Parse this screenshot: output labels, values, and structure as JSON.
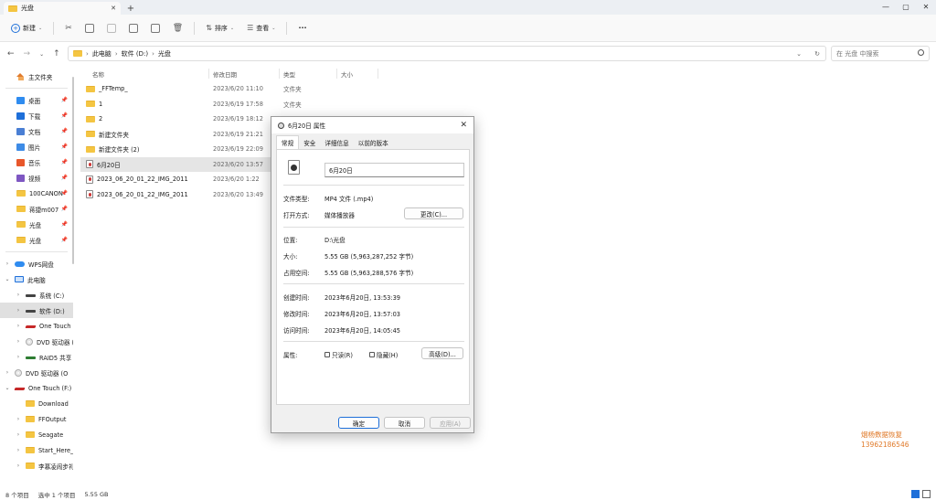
{
  "window": {
    "tab_title": "光盘",
    "controls": [
      "—",
      "▢",
      "✕"
    ]
  },
  "toolbar": {
    "new_label": "新建",
    "sort_label": "排序",
    "view_label": "查看",
    "more_label": "···"
  },
  "address": {
    "crumbs": [
      "此电脑",
      "软件 (D:)",
      "光盘"
    ],
    "search_placeholder": "在 光盘 中搜索"
  },
  "sidebar": {
    "home": "主文件夹",
    "quick": [
      {
        "label": "桌面",
        "icon": "desktop-icon"
      },
      {
        "label": "下载",
        "icon": "download-icon"
      },
      {
        "label": "文档",
        "icon": "document-icon"
      },
      {
        "label": "图片",
        "icon": "picture-icon"
      },
      {
        "label": "音乐",
        "icon": "music-icon"
      },
      {
        "label": "视频",
        "icon": "video-icon"
      },
      {
        "label": "100CANON",
        "icon": "folder-icon"
      },
      {
        "label": "蒋捷m007",
        "icon": "folder-icon"
      },
      {
        "label": "光盘",
        "icon": "folder-icon"
      },
      {
        "label": "光盘",
        "icon": "folder-icon"
      }
    ],
    "tree": [
      {
        "label": "WPS网盘",
        "icon": "cloud-icon",
        "chev": "›",
        "indent": 0
      },
      {
        "label": "此电脑",
        "icon": "pc-icon",
        "chev": "⌄",
        "indent": 0
      },
      {
        "label": "系统 (C:)",
        "icon": "drive-icon",
        "chev": "›",
        "indent": 1
      },
      {
        "label": "软件 (D:)",
        "icon": "drive-icon",
        "chev": "›",
        "indent": 1,
        "sel": true
      },
      {
        "label": "One Touch (F",
        "icon": "external-drive-icon",
        "chev": "›",
        "indent": 1
      },
      {
        "label": "DVD 驱动器 (",
        "icon": "dvd-icon",
        "chev": "›",
        "indent": 1
      },
      {
        "label": "RAID5 共享 (Z",
        "icon": "network-drive-icon",
        "chev": "›",
        "indent": 1
      },
      {
        "label": "DVD 驱动器 (O",
        "icon": "dvd-icon",
        "chev": "›",
        "indent": 0
      },
      {
        "label": "One Touch (F:)",
        "icon": "external-drive-icon",
        "chev": "⌄",
        "indent": 0
      },
      {
        "label": "Download",
        "icon": "folder-icon",
        "chev": "",
        "indent": 1
      },
      {
        "label": "FFOutput",
        "icon": "folder-icon",
        "chev": "›",
        "indent": 1
      },
      {
        "label": "Seagate",
        "icon": "folder-icon",
        "chev": "›",
        "indent": 1
      },
      {
        "label": "Start_Here_M",
        "icon": "folder-icon",
        "chev": "›",
        "indent": 1
      },
      {
        "label": "李慕凌闹步礼",
        "icon": "folder-icon",
        "chev": "›",
        "indent": 1
      }
    ]
  },
  "columns": {
    "name": "名称",
    "date": "修改日期",
    "type": "类型",
    "size": "大小"
  },
  "files": [
    {
      "name": "_FFTemp_",
      "date": "2023/6/20 11:10",
      "type": "文件夹",
      "kind": "folder"
    },
    {
      "name": "1",
      "date": "2023/6/19 17:58",
      "type": "文件夹",
      "kind": "folder"
    },
    {
      "name": "2",
      "date": "2023/6/19 18:12",
      "type": "",
      "kind": "folder"
    },
    {
      "name": "新建文件夹",
      "date": "2023/6/19 21:21",
      "type": "",
      "kind": "folder"
    },
    {
      "name": "新建文件夹 (2)",
      "date": "2023/6/19 22:09",
      "type": "",
      "kind": "folder"
    },
    {
      "name": "6月20日",
      "date": "2023/6/20 13:57",
      "type": "",
      "kind": "video",
      "sel": true
    },
    {
      "name": "2023_06_20_01_22_IMG_2011",
      "date": "2023/6/20 1:22",
      "type": "",
      "kind": "video"
    },
    {
      "name": "2023_06_20_01_22_IMG_2011",
      "date": "2023/6/20 13:49",
      "type": "",
      "kind": "video"
    }
  ],
  "status": {
    "count": "8 个项目",
    "selected": "选中 1 个项目",
    "size": "5.55 GB"
  },
  "watermark": {
    "line1": "烟杨数据恢复",
    "line2": "13962186546"
  },
  "dialog": {
    "title": "6月20日 属性",
    "tabs": [
      "常规",
      "安全",
      "详细信息",
      "以前的版本"
    ],
    "filename": "6月20日",
    "file_type_label": "文件类型:",
    "file_type_value": "MP4 文件 (.mp4)",
    "open_with_label": "打开方式:",
    "open_with_value": "媒体播放器",
    "change_btn": "更改(C)...",
    "location_label": "位置:",
    "location_value": "D:\\光盘",
    "size_label": "大小:",
    "size_value": "5.55 GB (5,963,287,252 字节)",
    "disk_size_label": "占用空间:",
    "disk_size_value": "5.55 GB (5,963,288,576 字节)",
    "created_label": "创建时间:",
    "created_value": "2023年6月20日, 13:53:39",
    "modified_label": "修改时间:",
    "modified_value": "2023年6月20日, 13:57:03",
    "accessed_label": "访问时间:",
    "accessed_value": "2023年6月20日, 14:05:45",
    "attr_label": "属性:",
    "readonly_label": "只读(R)",
    "hidden_label": "隐藏(H)",
    "advanced_btn": "高级(D)...",
    "ok_btn": "确定",
    "cancel_btn": "取消",
    "apply_btn": "应用(A)"
  }
}
